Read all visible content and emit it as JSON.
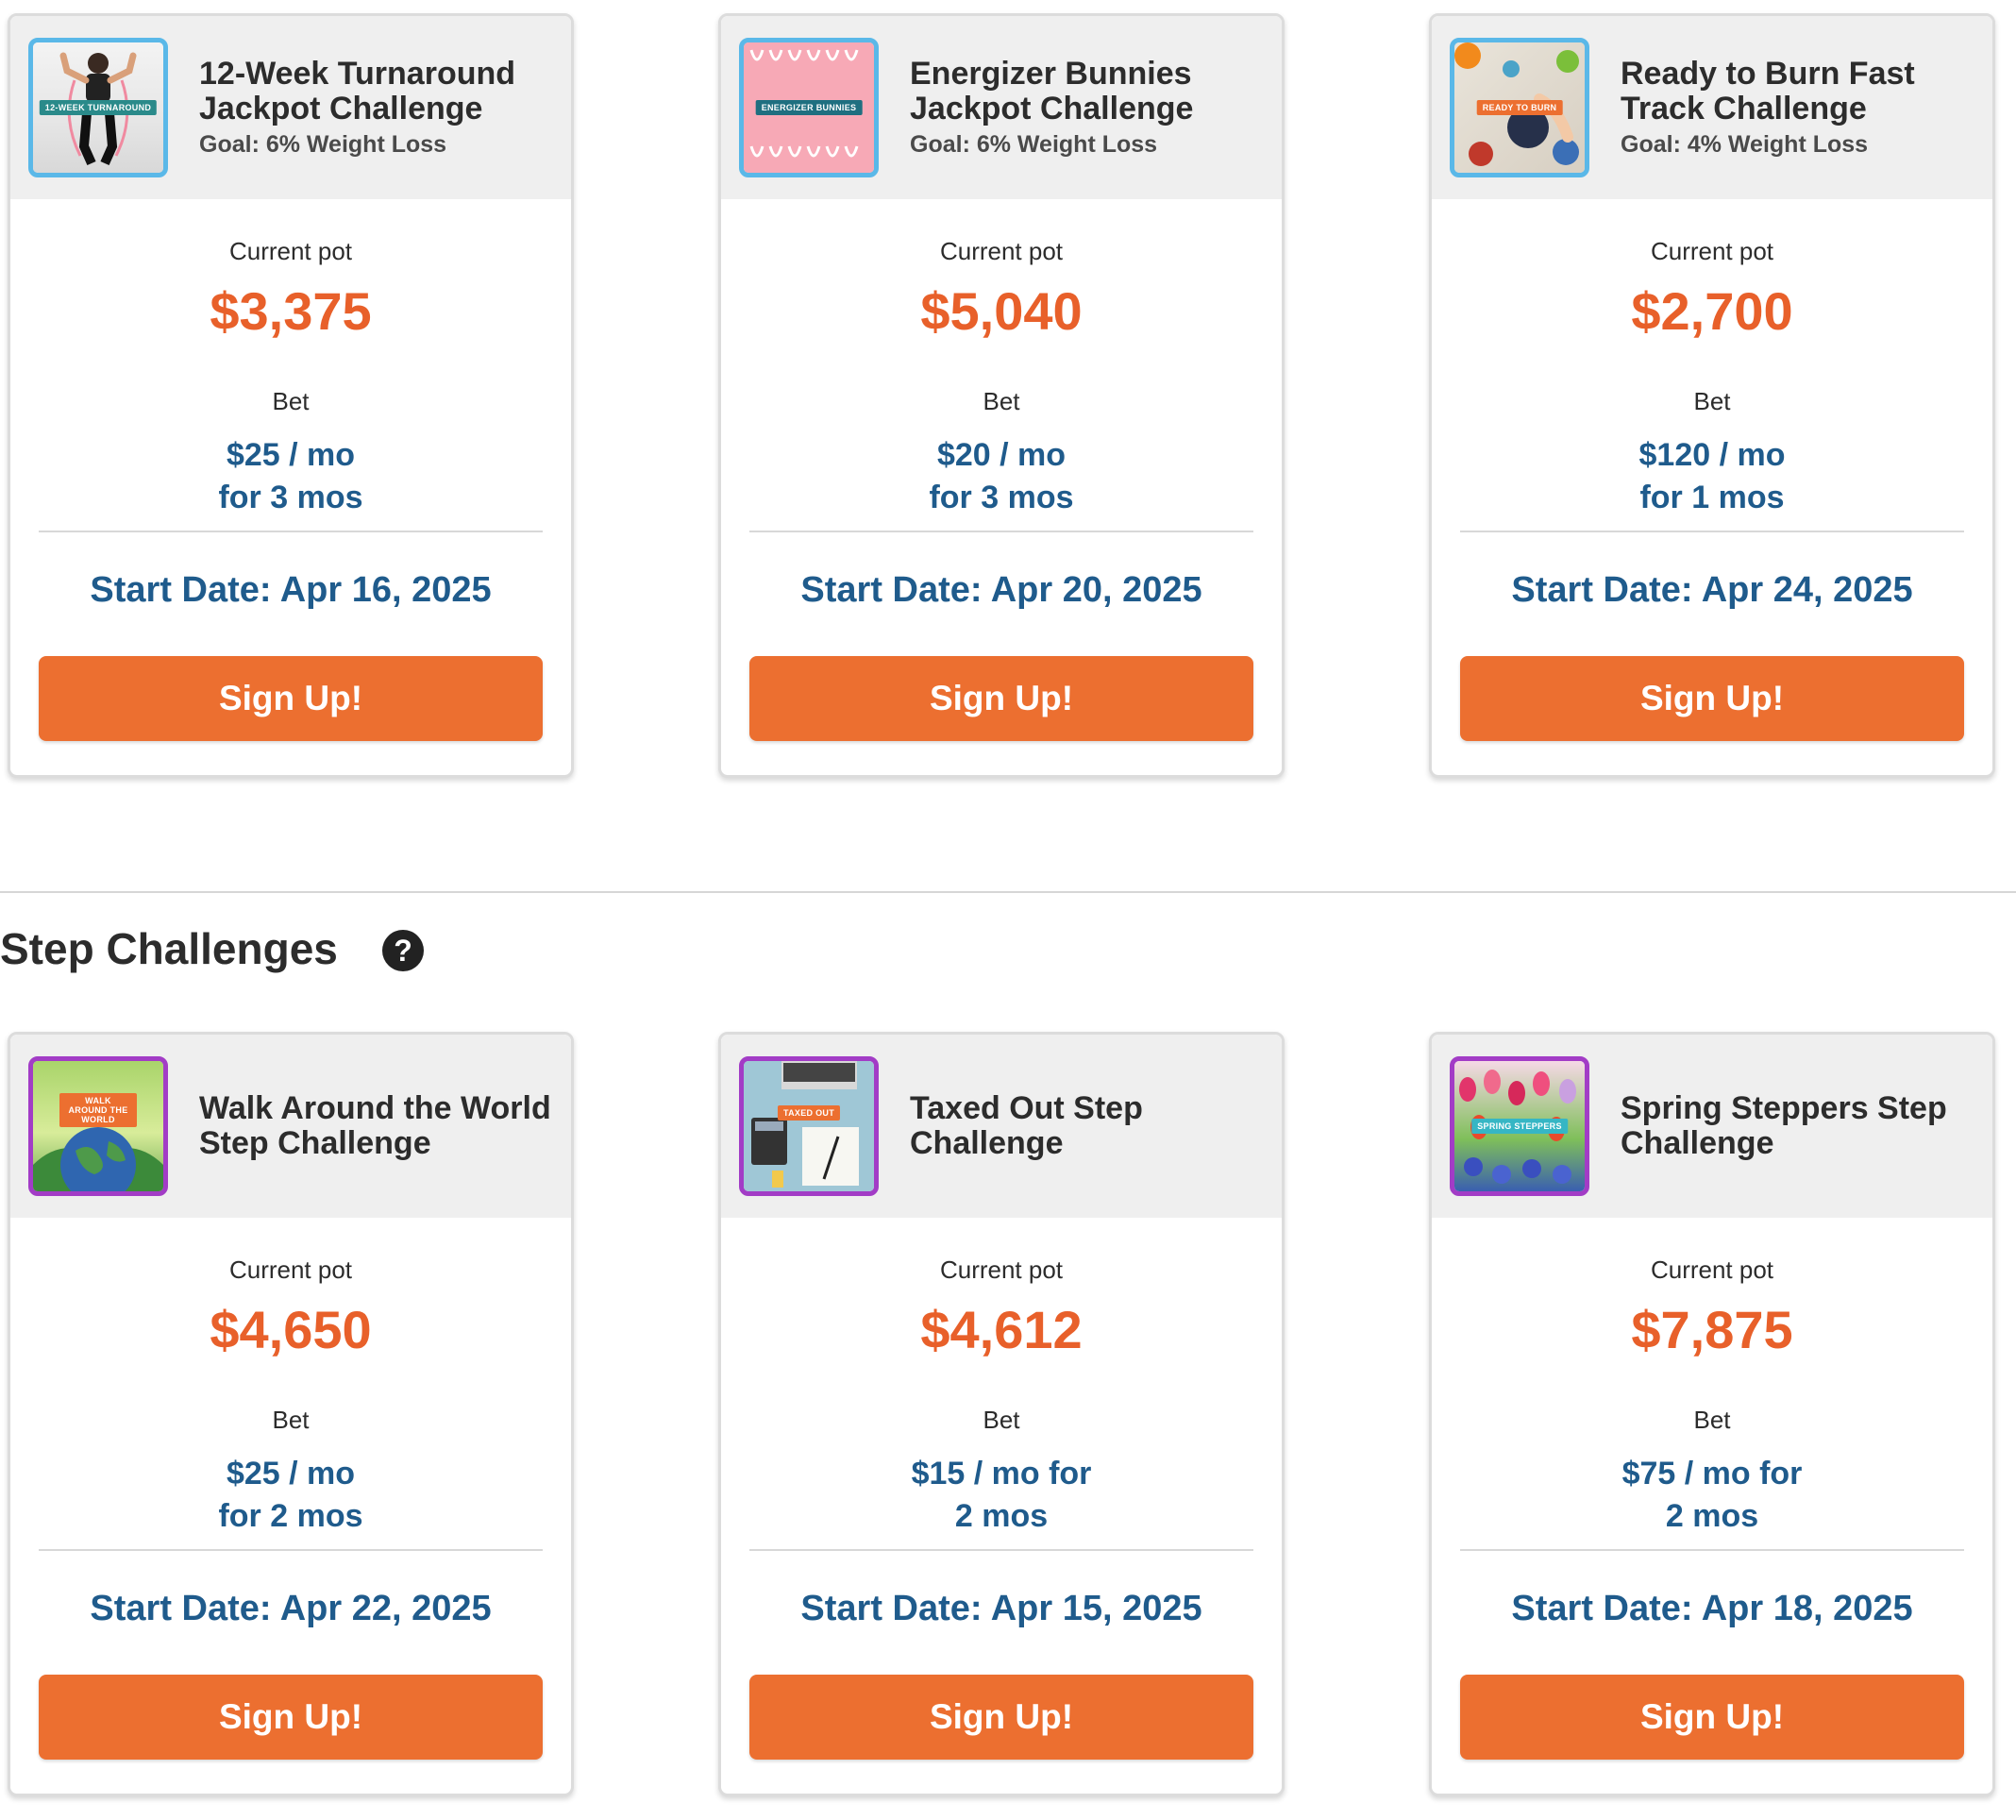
{
  "weight_cards": [
    {
      "title": "12-Week Turnaround Jackpot Challenge",
      "goal": "Goal: 6% Weight Loss",
      "thumb_label": "12-WEEK TURNAROUND",
      "pot_label": "Current pot",
      "pot": "$3,375",
      "bet_label": "Bet",
      "bet_line1": "$25 / mo",
      "bet_line2": "for 3 mos",
      "start_date": "Start Date: Apr 16, 2025",
      "signup": "Sign Up!"
    },
    {
      "title": "Energizer Bunnies Jackpot Challenge",
      "goal": "Goal: 6% Weight Loss",
      "thumb_label": "ENERGIZER BUNNIES",
      "pot_label": "Current pot",
      "pot": "$5,040",
      "bet_label": "Bet",
      "bet_line1": "$20 / mo",
      "bet_line2": "for 3 mos",
      "start_date": "Start Date: Apr 20, 2025",
      "signup": "Sign Up!"
    },
    {
      "title": "Ready to Burn Fast Track Challenge",
      "goal": "Goal: 4% Weight Loss",
      "thumb_label": "READY TO BURN",
      "pot_label": "Current pot",
      "pot": "$2,700",
      "bet_label": "Bet",
      "bet_line1": "$120 / mo",
      "bet_line2": "for 1 mos",
      "start_date": "Start Date: Apr 24, 2025",
      "signup": "Sign Up!"
    }
  ],
  "step_section": {
    "title": "Step Challenges",
    "help_icon": "?"
  },
  "step_cards": [
    {
      "title": "Walk Around the World Step Challenge",
      "thumb_label": "WALK AROUND THE WORLD",
      "pot_label": "Current pot",
      "pot": "$4,650",
      "bet_label": "Bet",
      "bet_line1": "$25 / mo",
      "bet_line2": "for 2 mos",
      "start_date": "Start Date: Apr 22, 2025",
      "signup": "Sign Up!"
    },
    {
      "title": "Taxed Out Step Challenge",
      "thumb_label": "TAXED OUT",
      "pot_label": "Current pot",
      "pot": "$4,612",
      "bet_label": "Bet",
      "bet_line1": "$15 / mo for",
      "bet_line2": "2 mos",
      "start_date": "Start Date: Apr 15, 2025",
      "signup": "Sign Up!"
    },
    {
      "title": "Spring Steppers Step Challenge",
      "thumb_label": "SPRING STEPPERS",
      "pot_label": "Current pot",
      "pot": "$7,875",
      "bet_label": "Bet",
      "bet_line1": "$75 / mo for",
      "bet_line2": "2 mos",
      "start_date": "Start Date: Apr 18, 2025",
      "signup": "Sign Up!"
    }
  ],
  "colors": {
    "accent_orange": "#ec6f30",
    "pot_orange": "#e8602a",
    "bet_blue": "#1f5b8c",
    "weight_thumb_border": "#5ab8e8",
    "step_thumb_border": "#a23cc6"
  }
}
